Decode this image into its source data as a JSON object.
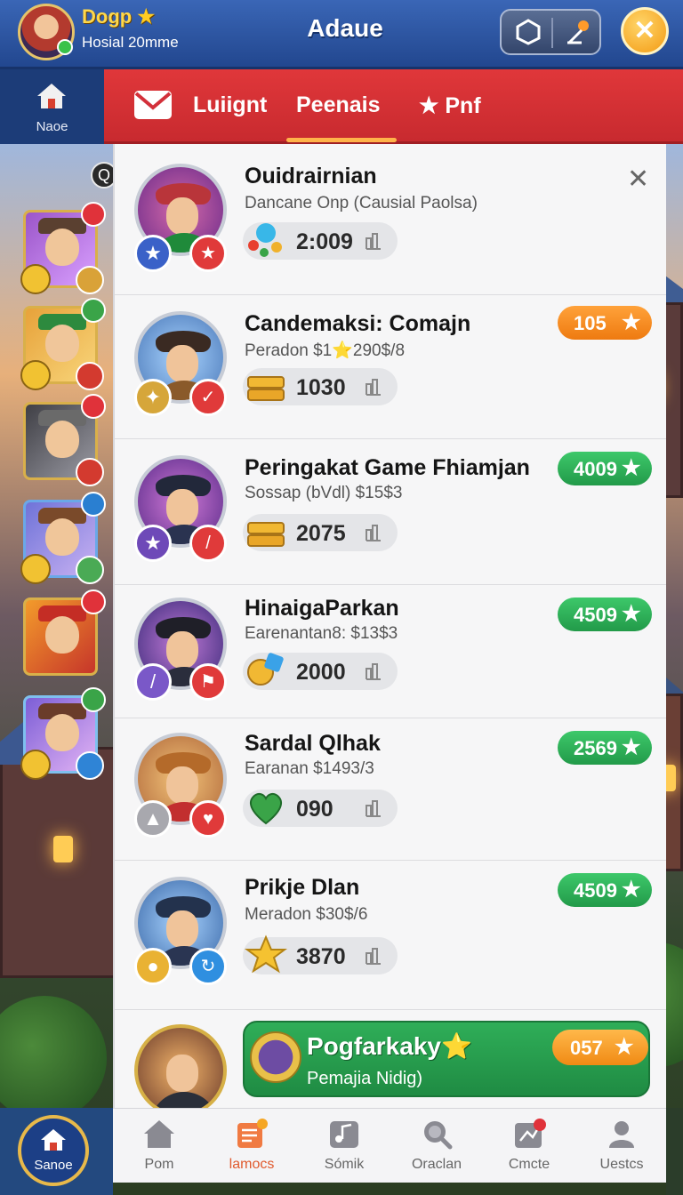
{
  "header": {
    "player_name": "Dogp",
    "player_subtitle": "Hosial 20mme",
    "app_title": "Adaue",
    "icons": {
      "left": "hexagon-icon",
      "right": "pin-icon",
      "close": "close-icon"
    },
    "close_glyph": "✕"
  },
  "home_tab": {
    "label": "Naoe"
  },
  "tabs": [
    {
      "label": "Luiignt",
      "active": false
    },
    {
      "label": "Peenais",
      "active": true
    },
    {
      "label": "Pnf",
      "active": false,
      "star": "★"
    }
  ],
  "side_badge": "Q",
  "list": [
    {
      "title": "Ouidrairnian",
      "subtitle": "Dancane Onp (Causial Paolsa)",
      "value": "2:009",
      "value_icon": "gems-icon",
      "score": null
    },
    {
      "title": "Candemaksi: Comajn",
      "subtitle": "Peradon $1⭐290$/8",
      "value": "1030",
      "value_icon": "gold-bars-icon",
      "score": {
        "value": "105",
        "color": "orange"
      }
    },
    {
      "title": "Peringakat Game Fhiamjan",
      "subtitle": "Sossap (bVdl) $15$3",
      "value": "2075",
      "value_icon": "gold-bars-icon",
      "score": {
        "value": "4009",
        "color": "green"
      }
    },
    {
      "title": "HinaigaParkan",
      "subtitle": "Earenantan8: $13$3",
      "value": "2000",
      "value_icon": "coin-gem-icon",
      "score": {
        "value": "4509",
        "color": "green"
      }
    },
    {
      "title": "Sardal Qlhak",
      "subtitle": "Earanan $1493/3",
      "value": "090",
      "value_icon": "heart-icon",
      "score": {
        "value": "2569",
        "color": "green"
      }
    },
    {
      "title": "Prikje Dlan",
      "subtitle": "Meradon $30$/6",
      "value": "3870",
      "value_icon": "star-icon",
      "score": {
        "value": "4509",
        "color": "green"
      }
    }
  ],
  "promo": {
    "title": "Pogfarkaky⭐",
    "subtitle": "Pemajia Nidig)",
    "score": "057"
  },
  "star_glyph": "★",
  "sane_button": {
    "label": "Sanoe"
  },
  "bottom_nav": [
    {
      "label": "Pom",
      "icon": "home-icon",
      "active": false
    },
    {
      "label": "lamocs",
      "icon": "notes-icon",
      "active": true
    },
    {
      "label": "Sómik",
      "icon": "music-icon",
      "active": false
    },
    {
      "label": "Oraclan",
      "icon": "search-icon",
      "active": false
    },
    {
      "label": "Cmcte",
      "icon": "map-icon",
      "active": false
    },
    {
      "label": "Uestcs",
      "icon": "user-icon",
      "active": false
    }
  ],
  "colors": {
    "header_blue": "#22478f",
    "tab_red": "#d3303a",
    "tab_active_underline": "#ffb34a",
    "score_orange": "#ee7a10",
    "score_green": "#229a49",
    "player_gold": "#ffd84a"
  }
}
